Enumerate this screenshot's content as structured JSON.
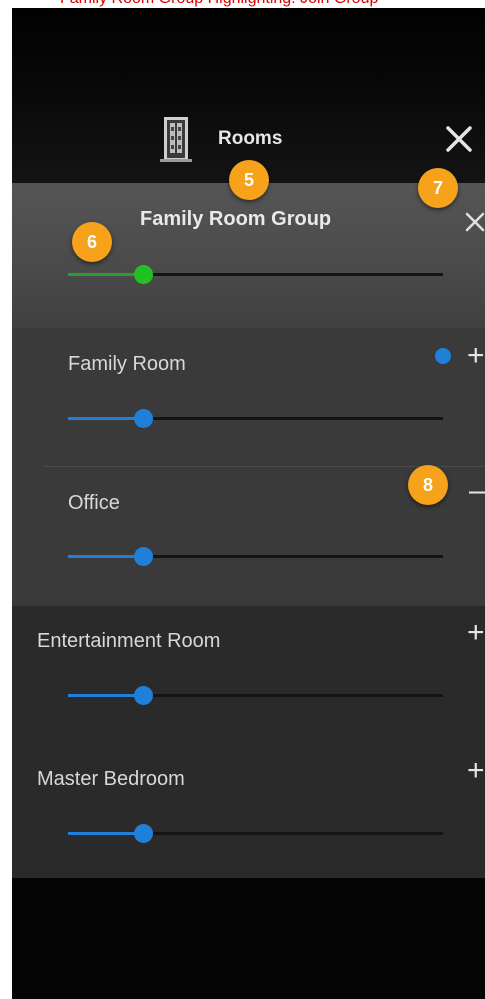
{
  "caption": "Family Room Group Highlighting: Join Group",
  "header": {
    "title": "Rooms",
    "icon": "rooms-door-icon",
    "close_icon": "close-icon"
  },
  "group": {
    "title": "Family Room Group",
    "volume": 0.2,
    "accent": "#22c022"
  },
  "rooms": [
    {
      "name": "Family Room",
      "volume": 0.2,
      "action": "+",
      "status_dot": true
    },
    {
      "name": "Office",
      "volume": 0.2,
      "action": "–",
      "status_dot": false
    },
    {
      "name": "Entertainment Room",
      "volume": 0.2,
      "action": "+",
      "status_dot": false
    },
    {
      "name": "Master Bedroom",
      "volume": 0.2,
      "action": "+",
      "status_dot": false
    }
  ],
  "badges": [
    "5",
    "6",
    "7",
    "8"
  ],
  "colors": {
    "slider_blue": "#1f7fd9",
    "badge_orange": "#f6a21b",
    "status_dot": "#1f7fd9"
  }
}
